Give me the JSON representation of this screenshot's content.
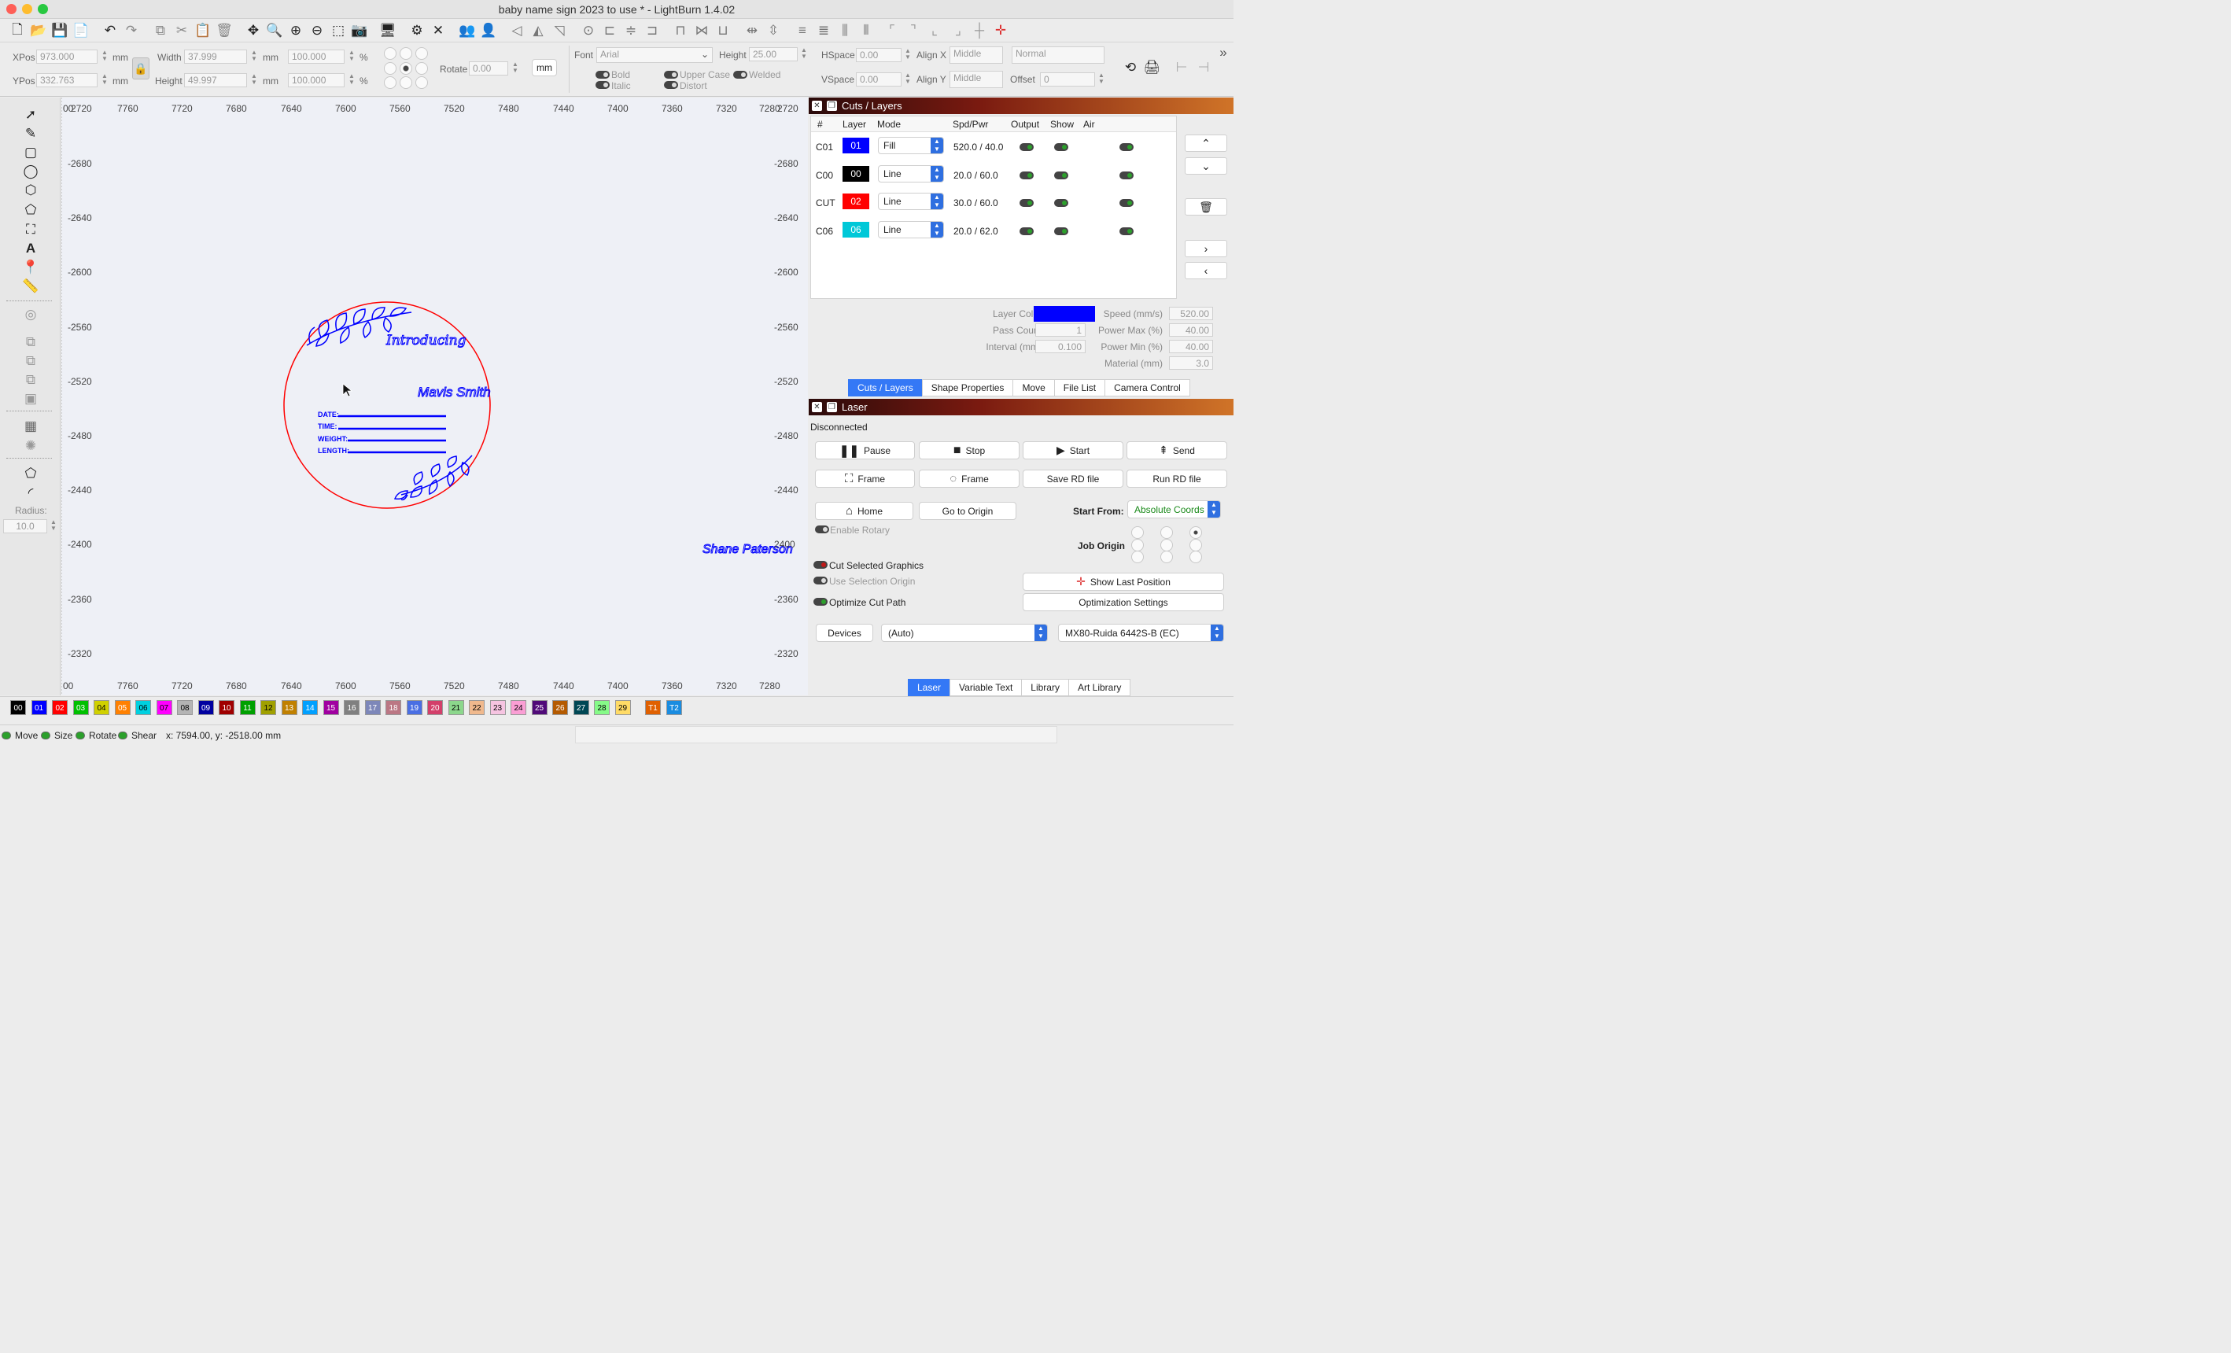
{
  "window": {
    "title": "baby name sign 2023 to use * - LightBurn 1.4.02"
  },
  "props": {
    "xpos_label": "XPos",
    "xpos": "973.000",
    "ypos_label": "YPos",
    "ypos": "332.763",
    "unit": "mm",
    "width_label": "Width",
    "width": "37.999",
    "height_label": "Height",
    "height": "49.997",
    "scale_x": "100.000",
    "scale_y": "100.000",
    "pct": "%",
    "rotate_label": "Rotate",
    "rotate": "0.00",
    "mm_button": "mm",
    "font_label": "Font",
    "font": "Arial",
    "font_height_label": "Height",
    "font_height": "25.00",
    "hspace_label": "HSpace",
    "hspace": "0.00",
    "vspace_label": "VSpace",
    "vspace": "0.00",
    "alignx_label": "Align X",
    "alignx": "Middle",
    "aligny_label": "Align Y",
    "aligny": "Middle",
    "style": "Normal",
    "offset_label": "Offset",
    "offset": "0",
    "bold": "Bold",
    "italic": "Italic",
    "upper": "Upper Case",
    "distort": "Distort",
    "welded": "Welded"
  },
  "ruler": {
    "top": [
      "00",
      "2720",
      "7760",
      "7720",
      "7680",
      "7640",
      "7600",
      "7560",
      "7520",
      "7480",
      "7440",
      "7400",
      "7360",
      "7320",
      "7280",
      "2720"
    ],
    "bottom": [
      "00",
      "7760",
      "7720",
      "7680",
      "7640",
      "7600",
      "7560",
      "7520",
      "7480",
      "7440",
      "7400",
      "7360",
      "7320",
      "7280"
    ],
    "left": [
      "-2680",
      "-2640",
      "-2600",
      "-2560",
      "-2520",
      "-2480",
      "-2440",
      "-2400",
      "-2360",
      "-2320"
    ],
    "right": [
      "-2680",
      "-2640",
      "-2600",
      "-2560",
      "-2520",
      "-2480",
      "-2440",
      "2400",
      "-2360",
      "-2320"
    ]
  },
  "design": {
    "introducing": "Introducing",
    "name": "Mavis Smith",
    "fields": [
      "DATE:",
      "TIME:",
      "WEIGHT:",
      "LENGTH:"
    ],
    "outside_text": "Shane Paterson"
  },
  "left_tools": {
    "radius_label": "Radius:",
    "radius": "10.0"
  },
  "cuts": {
    "title": "Cuts / Layers",
    "headers": [
      "#",
      "Layer",
      "Mode",
      "Spd/Pwr",
      "Output",
      "Show",
      "Air"
    ],
    "rows": [
      {
        "num": "C01",
        "layer": "01",
        "color": "#0000ff",
        "mode": "Fill",
        "spdpwr": "520.0 / 40.0"
      },
      {
        "num": "C00",
        "layer": "00",
        "color": "#000000",
        "mode": "Line",
        "spdpwr": "20.0 / 60.0"
      },
      {
        "num": "CUT",
        "layer": "02",
        "color": "#ff0000",
        "mode": "Line",
        "spdpwr": "30.0 / 60.0"
      },
      {
        "num": "C06",
        "layer": "06",
        "color": "#00c8d8",
        "mode": "Line",
        "spdpwr": "20.0 / 62.0"
      }
    ],
    "layer_color_label": "Layer Color",
    "layer_color": "#0000ff",
    "pass_count_label": "Pass Count",
    "pass_count": "1",
    "interval_label": "Interval (mm)",
    "interval": "0.100",
    "speed_label": "Speed (mm/s)",
    "speed": "520.00",
    "powermax_label": "Power Max (%)",
    "powermax": "40.00",
    "powermin_label": "Power Min (%)",
    "powermin": "40.00",
    "material_label": "Material (mm)",
    "material": "3.0",
    "tabs": [
      "Cuts / Layers",
      "Shape Properties",
      "Move",
      "File List",
      "Camera Control"
    ]
  },
  "laser": {
    "title": "Laser",
    "status": "Disconnected",
    "pause": "Pause",
    "stop": "Stop",
    "start": "Start",
    "send": "Send",
    "frame1": "Frame",
    "frame2": "Frame",
    "save_rd": "Save RD file",
    "run_rd": "Run RD file",
    "home": "Home",
    "goto_origin": "Go to Origin",
    "start_from_label": "Start From:",
    "start_from": "Absolute Coords",
    "enable_rotary": "Enable Rotary",
    "job_origin": "Job Origin",
    "cut_selected": "Cut Selected Graphics",
    "use_sel_origin": "Use Selection Origin",
    "show_last": "Show Last Position",
    "optimize": "Optimize Cut Path",
    "opt_settings": "Optimization Settings",
    "devices": "Devices",
    "port": "(Auto)",
    "device": "MX80-Ruida 6442S-B (EC)",
    "tabs": [
      "Laser",
      "Variable Text",
      "Library",
      "Art Library"
    ]
  },
  "palette": [
    {
      "label": "00",
      "color": "#000000"
    },
    {
      "label": "01",
      "color": "#0000ff"
    },
    {
      "label": "02",
      "color": "#ff0000"
    },
    {
      "label": "03",
      "color": "#00c000"
    },
    {
      "label": "04",
      "color": "#d0d000"
    },
    {
      "label": "05",
      "color": "#ff8000"
    },
    {
      "label": "06",
      "color": "#00d0e0"
    },
    {
      "label": "07",
      "color": "#ff00ff"
    },
    {
      "label": "08",
      "color": "#b4b4b4"
    },
    {
      "label": "09",
      "color": "#0000a0"
    },
    {
      "label": "10",
      "color": "#a00000"
    },
    {
      "label": "11",
      "color": "#00a000"
    },
    {
      "label": "12",
      "color": "#a0a000"
    },
    {
      "label": "13",
      "color": "#c08000"
    },
    {
      "label": "14",
      "color": "#00a0ff"
    },
    {
      "label": "15",
      "color": "#a000a0"
    },
    {
      "label": "16",
      "color": "#808080"
    },
    {
      "label": "17",
      "color": "#7d87b9"
    },
    {
      "label": "18",
      "color": "#bb7784"
    },
    {
      "label": "19",
      "color": "#4a6fe3"
    },
    {
      "label": "20",
      "color": "#d33f6a"
    },
    {
      "label": "21",
      "color": "#8cd78c"
    },
    {
      "label": "22",
      "color": "#f0b98d"
    },
    {
      "label": "23",
      "color": "#f6c4e1"
    },
    {
      "label": "24",
      "color": "#fa9ed4"
    },
    {
      "label": "25",
      "color": "#500a78"
    },
    {
      "label": "26",
      "color": "#b45a00"
    },
    {
      "label": "27",
      "color": "#004754"
    },
    {
      "label": "28",
      "color": "#86fa88"
    },
    {
      "label": "29",
      "color": "#ffdb66"
    },
    {
      "label": "T1",
      "color": "#e06000"
    },
    {
      "label": "T2",
      "color": "#1a8ce0"
    }
  ],
  "status": {
    "move": "Move",
    "size": "Size",
    "rotate": "Rotate",
    "shear": "Shear",
    "coords": "x: 7594.00, y: -2518.00 mm"
  }
}
